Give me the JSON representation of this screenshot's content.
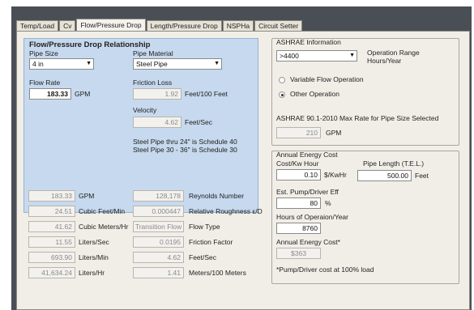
{
  "tabs": [
    "Temp/Load",
    "Cv",
    "Flow/Pressure Drop",
    "Length/Pressure Drop",
    "NSPHa",
    "Circuit Setter"
  ],
  "active_tab": "Flow/Pressure Drop",
  "flow": {
    "section_title": "Flow/Pressure Drop Relationship",
    "pipe_size_label": "Pipe Size",
    "pipe_size_value": "4 in",
    "pipe_material_label": "Pipe Material",
    "pipe_material_value": "Steel Pipe",
    "flow_rate_label": "Flow Rate",
    "flow_rate_value": "183.33",
    "flow_rate_unit": "GPM",
    "friction_loss_label": "Friction Loss",
    "friction_loss_value": "1.92",
    "friction_loss_unit": "Feet/100 Feet",
    "velocity_label": "Velocity",
    "velocity_value": "4.62",
    "velocity_unit": "Feet/Sec",
    "note_line1": "Steel Pipe thru 24\" is Schedule 40",
    "note_line2": "Steel Pipe 30 - 36\" is Schedule 30"
  },
  "conversions": [
    {
      "value": "183.33",
      "unit": "GPM"
    },
    {
      "value": "24.51",
      "unit": "Cubic Feet/Min"
    },
    {
      "value": "41.62",
      "unit": "Cubic Meters/Hr"
    },
    {
      "value": "11.55",
      "unit": "Liters/Sec"
    },
    {
      "value": "693.90",
      "unit": "Liters/Min"
    },
    {
      "value": "41,634.24",
      "unit": "Liters/Hr"
    }
  ],
  "properties": [
    {
      "value": "128,178",
      "label": "Reynolds Number"
    },
    {
      "value": "0.000447",
      "label": "Relative Roughness ε/D"
    },
    {
      "value": "Transition Flow",
      "label": "Flow Type"
    },
    {
      "value": "0.0195",
      "label": "Friction Factor"
    },
    {
      "value": "4.62",
      "label": "Feet/Sec"
    },
    {
      "value": "1.41",
      "label": "Meters/100 Meters"
    }
  ],
  "ashrae": {
    "group_title": "ASHRAE Information",
    "range_value": ">4400",
    "range_label_line1": "Operation Range",
    "range_label_line2": "Hours/Year",
    "variable_flow": "Variable Flow Operation",
    "other_operation": "Other Operation",
    "max_rate_label": "ASHRAE 90.1-2010 Max Rate for Pipe Size Selected",
    "max_rate_value": "210",
    "max_rate_unit": "GPM"
  },
  "energy": {
    "group_title": "Annual Energy Cost",
    "cost_label": "Cost/Kw Hour",
    "cost_value": "0.10",
    "cost_unit": "$/KwHr",
    "pipe_length_label": "Pipe Length (T.E.L.)",
    "pipe_length_value": "500.00",
    "pipe_length_unit": "Feet",
    "eff_label": "Est. Pump/Driver Eff",
    "eff_value": "80",
    "eff_unit": "%",
    "hours_label": "Hours of Operaion/Year",
    "hours_value": "8760",
    "annual_label": "Annual Energy Cost*",
    "annual_value": "$363",
    "footnote": "*Pump/Driver cost at 100% load"
  }
}
